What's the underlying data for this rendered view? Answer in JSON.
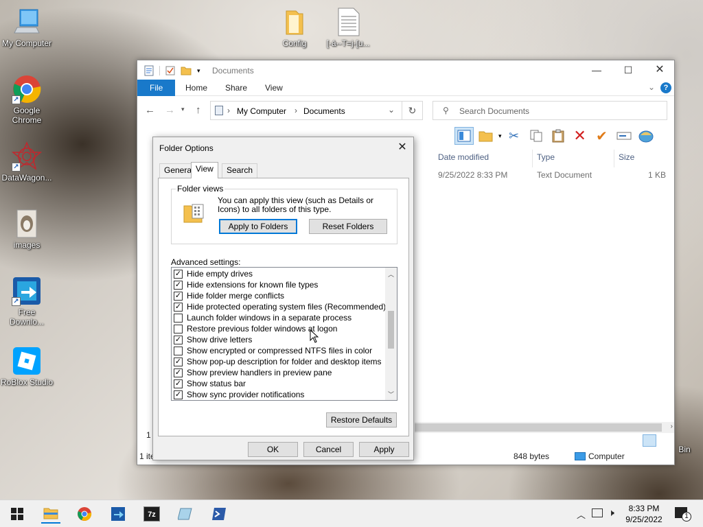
{
  "desktop": {
    "icons": [
      {
        "label": "My Computer"
      },
      {
        "label": "Google Chrome"
      },
      {
        "label": "DataWagon..."
      },
      {
        "label": "images"
      },
      {
        "label": "Free Downlo..."
      },
      {
        "label": "RoBlox Studio"
      },
      {
        "label": "Config"
      },
      {
        "label": "[-á--T=j-[u..."
      },
      {
        "label": "Bin"
      }
    ]
  },
  "explorer": {
    "title": "Documents",
    "ribbon_tabs": [
      "File",
      "Home",
      "Share",
      "View"
    ],
    "breadcrumb": [
      "My Computer",
      "Documents"
    ],
    "search_placeholder": "Search Documents",
    "columns": [
      "Date modified",
      "Type",
      "Size"
    ],
    "row": {
      "date": "9/25/2022 8:33 PM",
      "type": "Text Document",
      "size": "1 KB"
    },
    "status_left_1": "1",
    "status_left_2": "1 ite",
    "status_size": "848 bytes",
    "status_location": "Computer"
  },
  "dialog": {
    "title": "Folder Options",
    "tabs": [
      "General",
      "View",
      "Search"
    ],
    "active_tab": "View",
    "folder_views": {
      "legend": "Folder views",
      "description": "You can apply this view (such as Details or Icons) to all folders of this type.",
      "apply_button": "Apply to Folders",
      "reset_button": "Reset Folders"
    },
    "advanced_label": "Advanced settings:",
    "settings": [
      {
        "label": "Hide empty drives",
        "checked": true
      },
      {
        "label": "Hide extensions for known file types",
        "checked": true
      },
      {
        "label": "Hide folder merge conflicts",
        "checked": true
      },
      {
        "label": "Hide protected operating system files (Recommended)",
        "checked": true
      },
      {
        "label": "Launch folder windows in a separate process",
        "checked": false
      },
      {
        "label": "Restore previous folder windows at logon",
        "checked": false
      },
      {
        "label": "Show drive letters",
        "checked": true
      },
      {
        "label": "Show encrypted or compressed NTFS files in color",
        "checked": false
      },
      {
        "label": "Show pop-up description for folder and desktop items",
        "checked": true
      },
      {
        "label": "Show preview handlers in preview pane",
        "checked": true
      },
      {
        "label": "Show status bar",
        "checked": true
      },
      {
        "label": "Show sync provider notifications",
        "checked": true
      }
    ],
    "restore_defaults": "Restore Defaults",
    "ok": "OK",
    "cancel": "Cancel",
    "apply": "Apply"
  },
  "taskbar": {
    "apps": [
      "windows-start",
      "file-explorer",
      "chrome",
      "free-download-manager",
      "7zip",
      "notepad-app",
      "powershell"
    ],
    "time": "8:33 PM",
    "date": "9/25/2022",
    "notification_count": "1"
  }
}
